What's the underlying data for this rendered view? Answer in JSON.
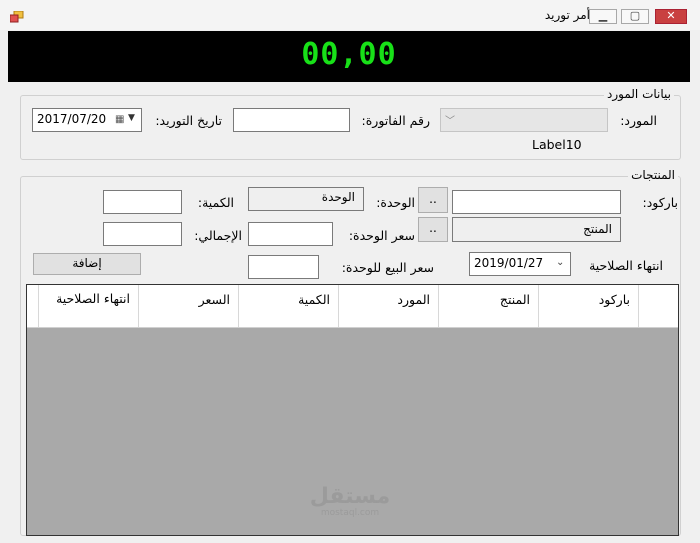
{
  "window": {
    "title": "أمر توريد",
    "app_icon": "app-icon",
    "minimize_icon": "minimize-icon",
    "maximize_icon": "maximize-icon",
    "close_icon": "close-icon"
  },
  "display": {
    "value": "00,00",
    "color": "#18e018"
  },
  "supplier_group": {
    "title": "بيانات المورد",
    "supplier_label": "المورد:",
    "invoice_label": "رقم الفاتورة:",
    "invoice_value": "",
    "date_label": "تاريخ التوريد:",
    "date_value": "2017/07/20",
    "status_label": "Label10"
  },
  "products_group": {
    "title": "المنتجات",
    "barcode_label": "باركود:",
    "barcode_value": "",
    "browse_label": "..",
    "unit_label": "الوحدة:",
    "unit_value": "الوحدة",
    "quantity_label": "الكمية:",
    "quantity_value": "",
    "product_value": "المنتج",
    "unit_price_label": "سعر الوحدة:",
    "unit_price_value": "",
    "total_label": "الإجمالي:",
    "total_value": "",
    "expiry_label": "انتهاء الصلاحية",
    "expiry_value": "2019/01/27",
    "sale_price_label": "سعر البيع للوحدة:",
    "sale_price_value": "",
    "add_label": "إضافة"
  },
  "table": {
    "columns": [
      "باركود",
      "المنتج",
      "المورد",
      "الكمية",
      "السعر",
      "انتهاء الصلاحية"
    ],
    "rows": []
  },
  "watermark": {
    "text": "مستقل",
    "subtext": "mostaql.com"
  }
}
